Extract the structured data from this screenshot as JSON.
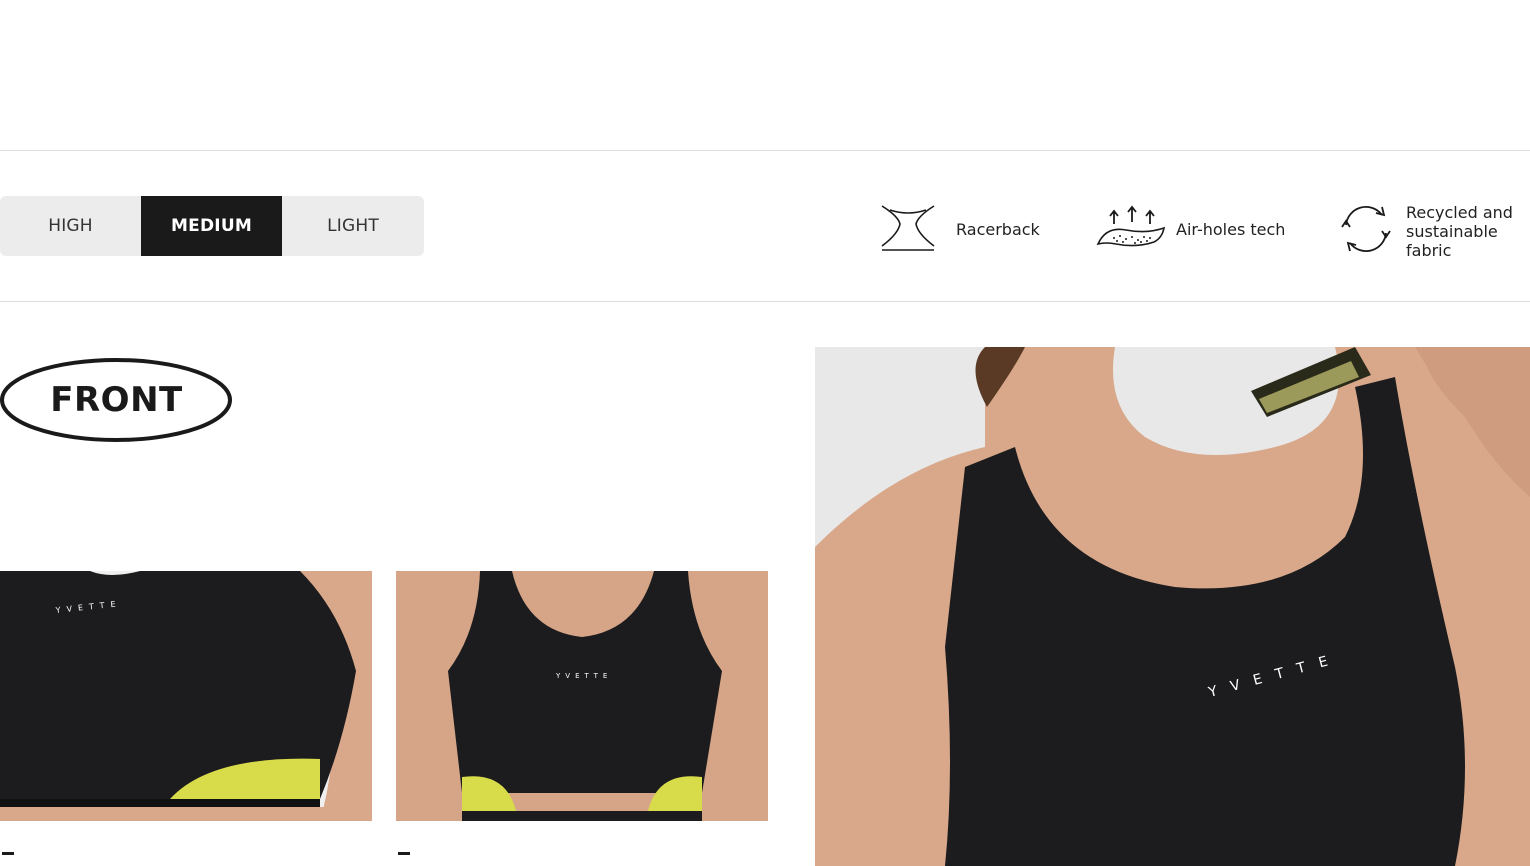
{
  "support_levels": {
    "high": "HIGH",
    "medium": "MEDIUM",
    "light": "LIGHT",
    "selected": "MEDIUM"
  },
  "features": [
    {
      "icon": "racerback-icon",
      "label": "Racerback"
    },
    {
      "icon": "air-holes-icon",
      "label": "Air-holes tech"
    },
    {
      "icon": "recycle-icon",
      "label": "Recycled and sustainable fabric"
    }
  ],
  "section": {
    "title": "FRONT"
  },
  "gallery": {
    "brand_text": "YVETTE",
    "photos": [
      "front-closeup-left",
      "front-full",
      "front-model-closeup"
    ],
    "captions": [
      "-",
      "-"
    ]
  },
  "colors": {
    "selected_bg": "#1a1a1a",
    "control_bg": "#ececec",
    "garment": "#1c1c1e",
    "accent": "#d9dc4a",
    "skin": "#d9a88a",
    "photo_bg": "#e6e6e6"
  }
}
